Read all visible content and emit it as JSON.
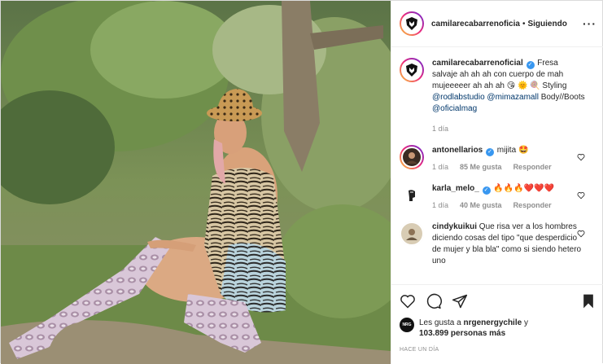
{
  "header": {
    "username": "camilarecabarrenoficia",
    "separator": "•",
    "follow_status": "Siguiendo",
    "more_label": "···"
  },
  "caption": {
    "username": "camilarecabarrenoficial",
    "text_part1": " Fresa salvaje ah ah ah con cuerpo de mah mujeeeeer ah ah ah ",
    "emojis": "😘 🌞 🍭",
    "text_part2": " Styling ",
    "mention1": "@rodlabstudio",
    "mention2": "@mimazamall",
    "text_part3": " Body//Boots ",
    "mention3": "@oficialmag",
    "time": "1 día"
  },
  "comments": [
    {
      "username": "antonellarios",
      "text": " mijita ",
      "emoji": "🤩",
      "time": "1 día",
      "likes": "85 Me gusta",
      "reply": "Responder"
    },
    {
      "username": "karla_melo_",
      "text": " ",
      "emoji": "🔥🔥🔥❤️❤️❤️",
      "time": "1 día",
      "likes": "40 Me gusta",
      "reply": "Responder"
    },
    {
      "username": "cindykuikui",
      "text": " Que risa ver a los hombres diciendo cosas del tipo \"que desperdicio de mujer y bla bla\" como si siendo hetero uno"
    }
  ],
  "likes": {
    "prefix": "Les gusta a ",
    "user": "nrgenergychile",
    "middle": " y",
    "count": "103.899 personas más",
    "avatar_label": "NRG"
  },
  "date": "HACE UN DÍA",
  "icons": {
    "like": "heart-icon",
    "comment": "comment-icon",
    "share": "share-icon",
    "save": "bookmark-icon"
  },
  "colors": {
    "verified": "#3897f0",
    "link": "#00376b",
    "muted": "#8e8e8e"
  }
}
